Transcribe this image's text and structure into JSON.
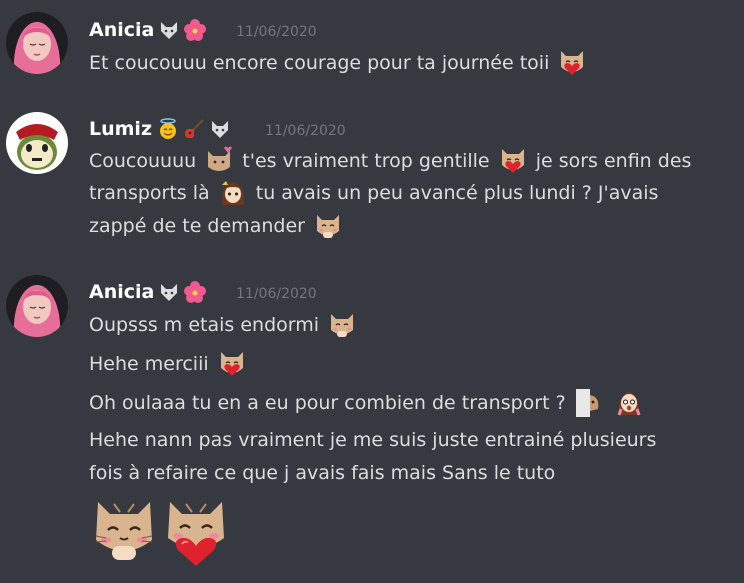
{
  "colors": {
    "background": "#36393f",
    "username": "#ffffff",
    "message_text": "#dcddde",
    "timestamp": "#72767d"
  },
  "groups": [
    {
      "author": "Anicia",
      "badges": [
        "wolf-badge-icon",
        "hibiscus-badge-icon"
      ],
      "timestamp": "11/06/2020",
      "lines": [
        {
          "segments": [
            "Et coucouuu encore courage pour ta journée toii"
          ],
          "emoji_after": [
            "cat-heart-emoji"
          ]
        }
      ]
    },
    {
      "author": "Lumiz",
      "badges": [
        "angel-face-badge-icon",
        "guitar-badge-icon",
        "wolf-badge-icon"
      ],
      "timestamp": "11/06/2020",
      "lines": [
        {
          "a": "Coucouuuu",
          "b": "t'es vraiment trop gentille",
          "c": "je sors enfin des"
        },
        {
          "a": "transports là",
          "b": "tu avais un peu avancé plus lundi ? J'avais"
        },
        {
          "a": "zappé de te demander"
        }
      ]
    },
    {
      "author": "Anicia",
      "badges": [
        "wolf-badge-icon",
        "hibiscus-badge-icon"
      ],
      "timestamp": "11/06/2020",
      "lines": [
        {
          "a": "Oupsss m etais endormi"
        },
        {
          "a": "Hehe merciii"
        },
        {
          "a": "Oh oulaaa tu en a eu pour combien de transport ?"
        },
        {
          "a": "Hehe nann pas vraiment je me suis juste entrainé plusieurs"
        },
        {
          "a": "fois à  refaire ce que j avais fais mais Sans le tuto"
        }
      ]
    }
  ]
}
